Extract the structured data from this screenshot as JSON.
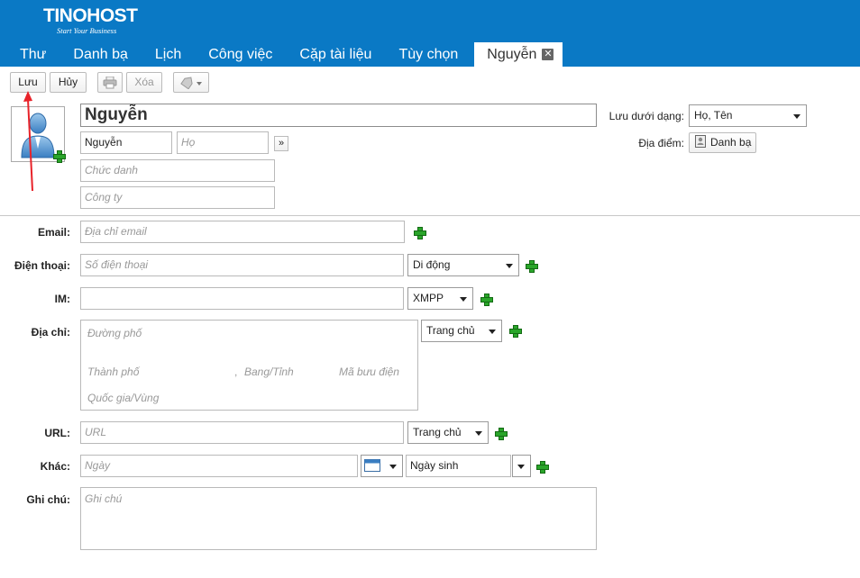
{
  "brand": {
    "name": "TINOHOST",
    "tagline": "Start Your Business"
  },
  "tabs": [
    {
      "label": "Thư"
    },
    {
      "label": "Danh bạ"
    },
    {
      "label": "Lịch"
    },
    {
      "label": "Công việc"
    },
    {
      "label": "Cặp tài liệu"
    },
    {
      "label": "Tùy chọn"
    },
    {
      "label": "Nguyễn",
      "active": true,
      "close_icon": "close-icon"
    }
  ],
  "toolbar": {
    "save_label": "Lưu",
    "cancel_label": "Hủy",
    "print_icon": "print-icon",
    "delete_label": "Xóa",
    "tag_icon": "tag-icon"
  },
  "contact": {
    "display_name": "Nguyễn",
    "first_name": "Nguyễn",
    "last_name_placeholder": "Họ",
    "expand_label": "»",
    "job_title_placeholder": "Chức danh",
    "company_placeholder": "Công ty",
    "file_as_label": "Lưu dưới dạng:",
    "file_as_value": "Họ, Tên",
    "location_label": "Địa điểm:",
    "location_value": "Danh bạ"
  },
  "fields": {
    "email": {
      "label": "Email:",
      "placeholder": "Địa chỉ email"
    },
    "phone": {
      "label": "Điện thoại:",
      "placeholder": "Số điện thoại",
      "type": "Di động"
    },
    "im": {
      "label": "IM:",
      "value": "",
      "type": "XMPP"
    },
    "address": {
      "label": "Địa chỉ:",
      "street_placeholder": "Đường phố",
      "city_placeholder": "Thành phố",
      "separator": ",",
      "state_placeholder": "Bang/Tỉnh",
      "postal_placeholder": "Mã bưu điện",
      "country_placeholder": "Quốc gia/Vùng",
      "type": "Trang chủ"
    },
    "url": {
      "label": "URL:",
      "placeholder": "URL",
      "type": "Trang chủ"
    },
    "other": {
      "label": "Khác:",
      "placeholder": "Ngày",
      "type": "Ngày sinh"
    },
    "notes": {
      "label": "Ghi chú:",
      "placeholder": "Ghi chú"
    }
  },
  "colors": {
    "header": "#0a79c5",
    "plus": "#2aa52a",
    "arrow": "#e8232a"
  }
}
